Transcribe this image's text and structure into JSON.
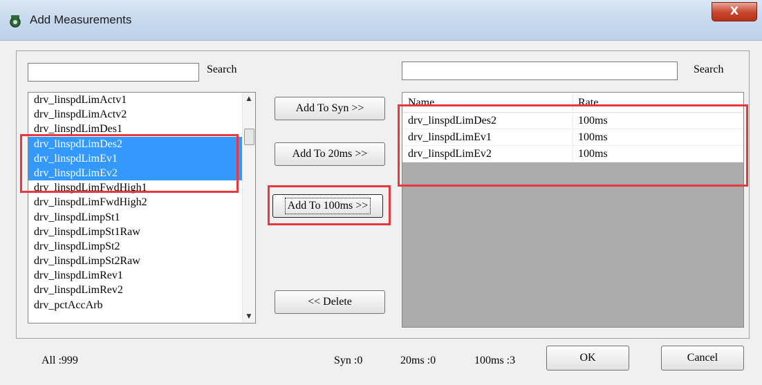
{
  "window": {
    "title": "Add Measurements",
    "close_label": "X"
  },
  "left": {
    "search_value": "",
    "search_label": "Search",
    "items": [
      {
        "label": "drv_linspdLimActv1",
        "selected": false
      },
      {
        "label": "drv_linspdLimActv2",
        "selected": false
      },
      {
        "label": "drv_linspdLimDes1",
        "selected": false
      },
      {
        "label": "drv_linspdLimDes2",
        "selected": true
      },
      {
        "label": "drv_linspdLimEv1",
        "selected": true
      },
      {
        "label": "drv_linspdLimEv2",
        "selected": true
      },
      {
        "label": "drv_linspdLimFwdHigh1",
        "selected": false
      },
      {
        "label": "drv_linspdLimFwdHigh2",
        "selected": false
      },
      {
        "label": "drv_linspdLimpSt1",
        "selected": false
      },
      {
        "label": "drv_linspdLimpSt1Raw",
        "selected": false
      },
      {
        "label": "drv_linspdLimpSt2",
        "selected": false
      },
      {
        "label": "drv_linspdLimpSt2Raw",
        "selected": false
      },
      {
        "label": "drv_linspdLimRev1",
        "selected": false
      },
      {
        "label": "drv_linspdLimRev2",
        "selected": false
      },
      {
        "label": "drv_pctAccArb",
        "selected": false
      }
    ]
  },
  "buttons": {
    "add_syn": "Add To Syn >>",
    "add_20ms": "Add To 20ms >>",
    "add_100ms": "Add To 100ms >>",
    "delete": "<< Delete",
    "ok": "OK",
    "cancel": "Cancel"
  },
  "right": {
    "search_value": "",
    "search_label": "Search",
    "columns": [
      "Name",
      "Rate"
    ],
    "rows": [
      {
        "name": "drv_linspdLimDes2",
        "rate": "100ms"
      },
      {
        "name": "drv_linspdLimEv1",
        "rate": "100ms"
      },
      {
        "name": "drv_linspdLimEv2",
        "rate": "100ms"
      }
    ]
  },
  "status": {
    "all": "All :999",
    "syn": "Syn :0",
    "ms20": "20ms :0",
    "ms100": "100ms :3"
  },
  "colors": {
    "selection": "#3399ff",
    "highlight_box": "#e8383d",
    "listview_bg": "#ababab"
  }
}
